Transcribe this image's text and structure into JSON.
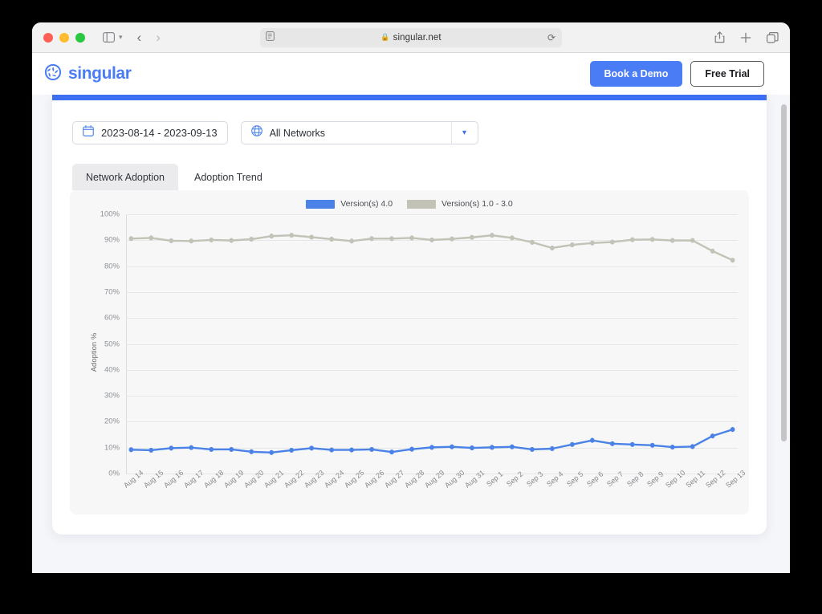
{
  "browser": {
    "url": "singular.net",
    "lock_icon": "lock-icon",
    "reader_icon": "reader-view-icon",
    "reload_icon": "reload-icon",
    "sidebar_icon": "sidebar-toggle-icon",
    "back_icon": "nav-back-icon",
    "forward_icon": "nav-forward-icon",
    "share_icon": "share-icon",
    "newtab_icon": "plus-icon",
    "tabs_icon": "tab-overview-icon"
  },
  "header": {
    "brand_name": "singular",
    "brand_icon": "singular-aperture-logo",
    "book_demo_label": "Book a Demo",
    "free_trial_label": "Free Trial"
  },
  "filters": {
    "date_range": "2023-08-14 - 2023-09-13",
    "calendar_icon": "calendar-icon",
    "network": "All Networks",
    "globe_icon": "globe-icon",
    "chevron_icon": "chevron-down-icon"
  },
  "tabs": [
    {
      "label": "Network Adoption",
      "active": false
    },
    {
      "label": "Adoption Trend",
      "active": true
    }
  ],
  "colors": {
    "series_blue": "#4a82e8",
    "series_gray": "#c2c2b7",
    "brand_blue": "#4a7cf6",
    "progress_blue": "#3b6ef0"
  },
  "chart_data": {
    "type": "line",
    "title": "",
    "xlabel": "",
    "ylabel": "Adoption %",
    "ylim": [
      0,
      100
    ],
    "ytick_labels": [
      "100%",
      "90%",
      "80%",
      "70%",
      "60%",
      "50%",
      "40%",
      "30%",
      "20%",
      "10%",
      "0%"
    ],
    "ytick_values": [
      100,
      90,
      80,
      70,
      60,
      50,
      40,
      30,
      20,
      10,
      0
    ],
    "grid": true,
    "legend_position": "top-center",
    "categories": [
      "Aug 14",
      "Aug 15",
      "Aug 16",
      "Aug 17",
      "Aug 18",
      "Aug 19",
      "Aug 20",
      "Aug 21",
      "Aug 22",
      "Aug 23",
      "Aug 24",
      "Aug 25",
      "Aug 26",
      "Aug 27",
      "Aug 28",
      "Aug 29",
      "Aug 30",
      "Aug 31",
      "Sep 1",
      "Sep 2",
      "Sep 3",
      "Sep 4",
      "Sep 5",
      "Sep 6",
      "Sep 7",
      "Sep 8",
      "Sep 9",
      "Sep 10",
      "Sep 11",
      "Sep 12",
      "Sep 13"
    ],
    "series": [
      {
        "name": "Version(s) 4.0",
        "color": "#4a82e8",
        "values": [
          9.2,
          9.0,
          9.8,
          10.0,
          9.3,
          9.3,
          8.4,
          8.1,
          9.0,
          9.8,
          9.1,
          9.1,
          9.3,
          8.3,
          9.4,
          10.1,
          10.3,
          9.9,
          10.1,
          10.3,
          9.3,
          9.6,
          11.2,
          12.8,
          11.5,
          11.2,
          10.9,
          10.2,
          10.4,
          14.5,
          17.0
        ]
      },
      {
        "name": "Version(s) 1.0 - 3.0",
        "color": "#c2c2b7",
        "values": [
          90.6,
          90.9,
          89.8,
          89.7,
          90.1,
          89.9,
          90.4,
          91.6,
          91.9,
          91.2,
          90.4,
          89.7,
          90.6,
          90.6,
          90.9,
          90.1,
          90.5,
          91.1,
          91.9,
          90.9,
          89.2,
          87.0,
          88.2,
          88.9,
          89.3,
          90.2,
          90.3,
          89.9,
          89.9,
          85.8,
          82.3
        ]
      }
    ]
  }
}
